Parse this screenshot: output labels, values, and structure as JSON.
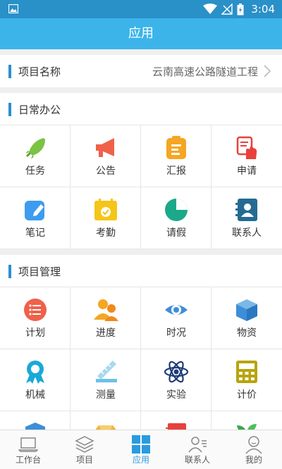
{
  "status_bar": {
    "time": "3:04"
  },
  "title_bar": {
    "title": "应用"
  },
  "project": {
    "label": "项目名称",
    "value": "云南高速公路隧道工程"
  },
  "sections": [
    {
      "title": "日常办公",
      "items": [
        {
          "label": "任务",
          "icon": "rocket-icon"
        },
        {
          "label": "公告",
          "icon": "megaphone-icon"
        },
        {
          "label": "汇报",
          "icon": "clipboard-icon"
        },
        {
          "label": "申请",
          "icon": "hand-document-icon"
        },
        {
          "label": "笔记",
          "icon": "pencil-icon"
        },
        {
          "label": "考勤",
          "icon": "calendar-check-icon"
        },
        {
          "label": "请假",
          "icon": "pie-clock-icon"
        },
        {
          "label": "联系人",
          "icon": "contact-book-icon"
        }
      ]
    },
    {
      "title": "项目管理",
      "items": [
        {
          "label": "计划",
          "icon": "list-icon"
        },
        {
          "label": "进度",
          "icon": "people-icon"
        },
        {
          "label": "时况",
          "icon": "eye-icon"
        },
        {
          "label": "物资",
          "icon": "box-icon"
        },
        {
          "label": "机械",
          "icon": "medal-icon"
        },
        {
          "label": "测量",
          "icon": "ruler-icon"
        },
        {
          "label": "实验",
          "icon": "atom-icon"
        },
        {
          "label": "计价",
          "icon": "calculator-icon"
        }
      ]
    }
  ],
  "tabs": [
    {
      "label": "工作台",
      "icon": "laptop-icon",
      "active": false
    },
    {
      "label": "项目",
      "icon": "layers-icon",
      "active": false
    },
    {
      "label": "应用",
      "icon": "grid-icon",
      "active": true
    },
    {
      "label": "联系人",
      "icon": "contacts-icon",
      "active": false
    },
    {
      "label": "我的",
      "icon": "profile-icon",
      "active": false
    }
  ],
  "colors": {
    "title_bar": "#3cb4ea",
    "status_bar": "#2a90c8",
    "accent": "#2a9be0"
  }
}
